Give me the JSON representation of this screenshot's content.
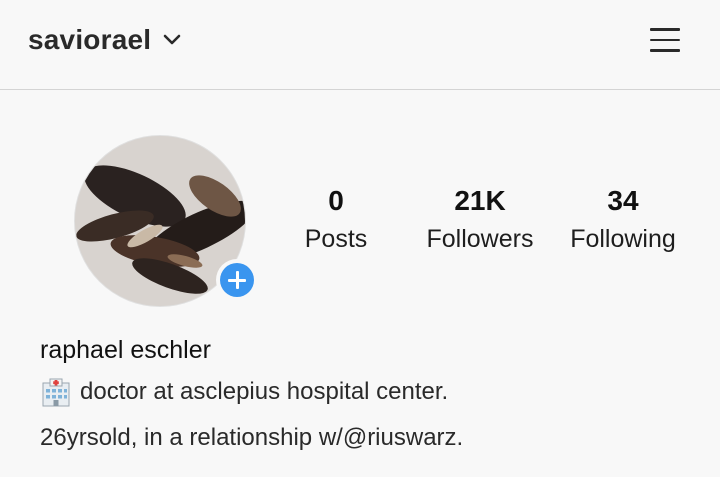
{
  "header": {
    "username": "saviorael",
    "switch_icon": "chevron-down-icon",
    "menu_icon": "hamburger-menu-icon"
  },
  "profile": {
    "avatar_alt": "profile photo",
    "add_story_icon": "plus-icon",
    "stats": [
      {
        "value": "0",
        "label": "Posts"
      },
      {
        "value": "21K",
        "label": "Followers"
      },
      {
        "value": "34",
        "label": "Following"
      }
    ],
    "full_name": "raphael eschler",
    "bio": [
      {
        "icon": "hospital-icon",
        "text": "doctor at asclepius hospital center."
      },
      {
        "text": "26yrsold, in a relationship w/@riuswarz."
      }
    ]
  },
  "colors": {
    "background": "#f8f8f8",
    "accent_blue": "#3a95ef",
    "divider": "#d4d4d4"
  }
}
